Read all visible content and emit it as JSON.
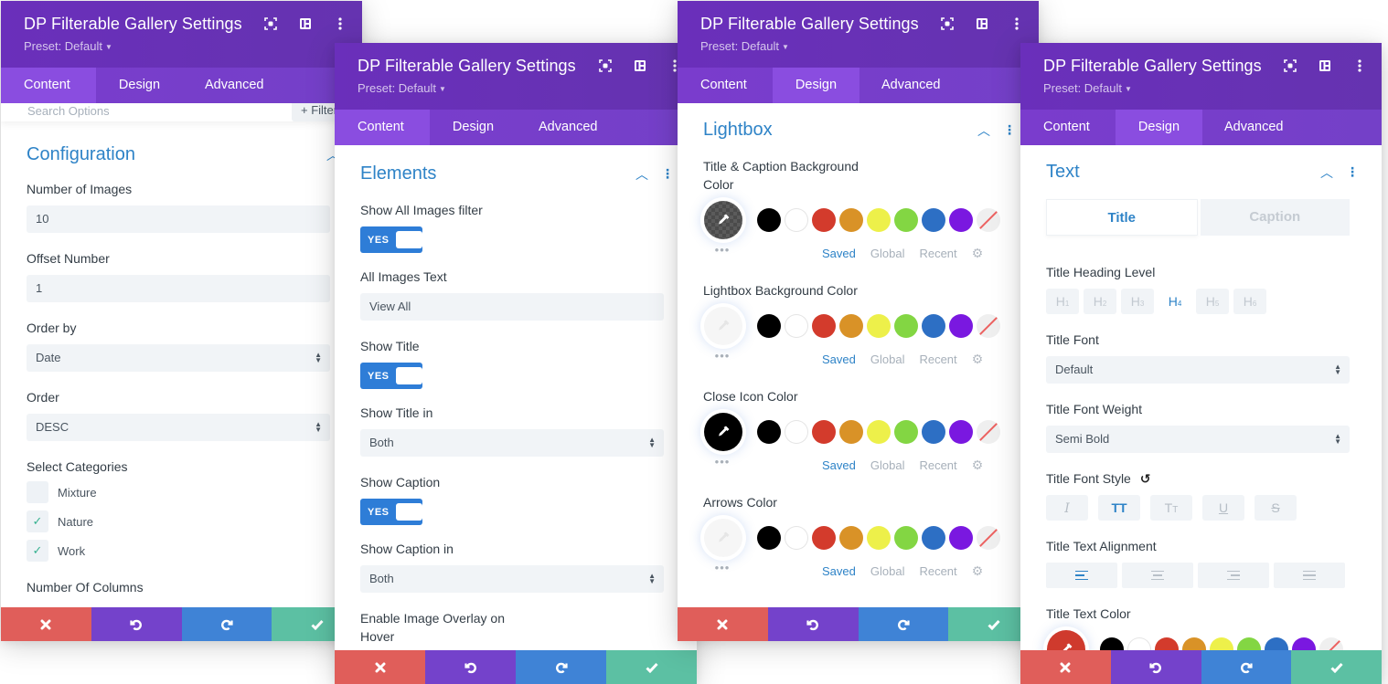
{
  "panel_title": "DP Filterable Gallery Settings",
  "preset_label": "Preset: Default",
  "header_icons": [
    "fullscreen-icon",
    "split-view-icon",
    "more-options-icon"
  ],
  "tabs": [
    "Content",
    "Design",
    "Advanced"
  ],
  "footer_icons": [
    "close-icon",
    "undo-icon",
    "redo-icon",
    "check-icon"
  ],
  "colors": {
    "header_bg": "#6531b4",
    "tabs_bg": "#7a3ccd",
    "active_tab_bg": "#8a4de0",
    "accent_blue": "#2e83c7",
    "toggle_blue": "#2e7dd7",
    "cancel": "#e05e5a",
    "undo": "#7442cb",
    "redo": "#3f83d6",
    "save": "#5cc0a3"
  },
  "swatches": [
    "#000000",
    "#ffffff",
    "#d33b2c",
    "#d99227",
    "#edf04a",
    "#83d643",
    "#2d6fc4",
    "#7a18e0",
    "none"
  ],
  "color_tabs": [
    "Saved",
    "Global",
    "Recent"
  ],
  "panel1": {
    "active_tab": "Content",
    "search_placeholder": "Search Options",
    "filter_label": "+ Filter",
    "section_title": "Configuration",
    "fields": {
      "num_images_label": "Number of Images",
      "num_images_value": "10",
      "offset_label": "Offset Number",
      "offset_value": "1",
      "order_by_label": "Order by",
      "order_by_value": "Date",
      "order_label": "Order",
      "order_value": "DESC",
      "categories_label": "Select Categories",
      "columns_label": "Number Of Columns"
    },
    "categories": [
      {
        "label": "Mixture",
        "checked": false
      },
      {
        "label": "Nature",
        "checked": true
      },
      {
        "label": "Work",
        "checked": true
      }
    ]
  },
  "panel2": {
    "active_tab": "Content",
    "section_title": "Elements",
    "show_all_label": "Show All Images filter",
    "toggle_yes": "YES",
    "all_images_text_label": "All Images Text",
    "all_images_text_value": "View All",
    "show_title_label": "Show Title",
    "show_title_in_label": "Show Title in",
    "show_title_in_value": "Both",
    "show_caption_label": "Show Caption",
    "show_caption_in_label": "Show Caption in",
    "show_caption_in_value": "Both",
    "overlay_label": "Enable Image Overlay on Hover"
  },
  "panel3": {
    "active_tab": "Design",
    "section_title": "Lightbox",
    "pickers": [
      {
        "label": "Title & Caption Background Color",
        "current": "transparent-dark"
      },
      {
        "label": "Lightbox Background Color",
        "current": "#ffffff"
      },
      {
        "label": "Close Icon Color",
        "current": "#000000"
      },
      {
        "label": "Arrows Color",
        "current": "#ffffff"
      }
    ]
  },
  "panel4": {
    "active_tab": "Design",
    "section_title": "Text",
    "subtabs": [
      "Title",
      "Caption"
    ],
    "active_subtab": "Title",
    "heading_level_label": "Title Heading Level",
    "heading_levels": [
      "H1",
      "H2",
      "H3",
      "H4",
      "H5",
      "H6"
    ],
    "heading_level_selected": "H4",
    "font_label": "Title Font",
    "font_value": "Default",
    "font_weight_label": "Title Font Weight",
    "font_weight_value": "Semi Bold",
    "font_style_label": "Title Font Style",
    "font_styles": [
      "italic",
      "uppercase",
      "capitalize",
      "underline",
      "strikethrough"
    ],
    "font_style_selected": "uppercase",
    "alignment_label": "Title Text Alignment",
    "alignments": [
      "left",
      "center",
      "right",
      "justify"
    ],
    "alignment_selected": "left",
    "text_color_label": "Title Text Color",
    "text_color_current": "#cf3a2d"
  }
}
